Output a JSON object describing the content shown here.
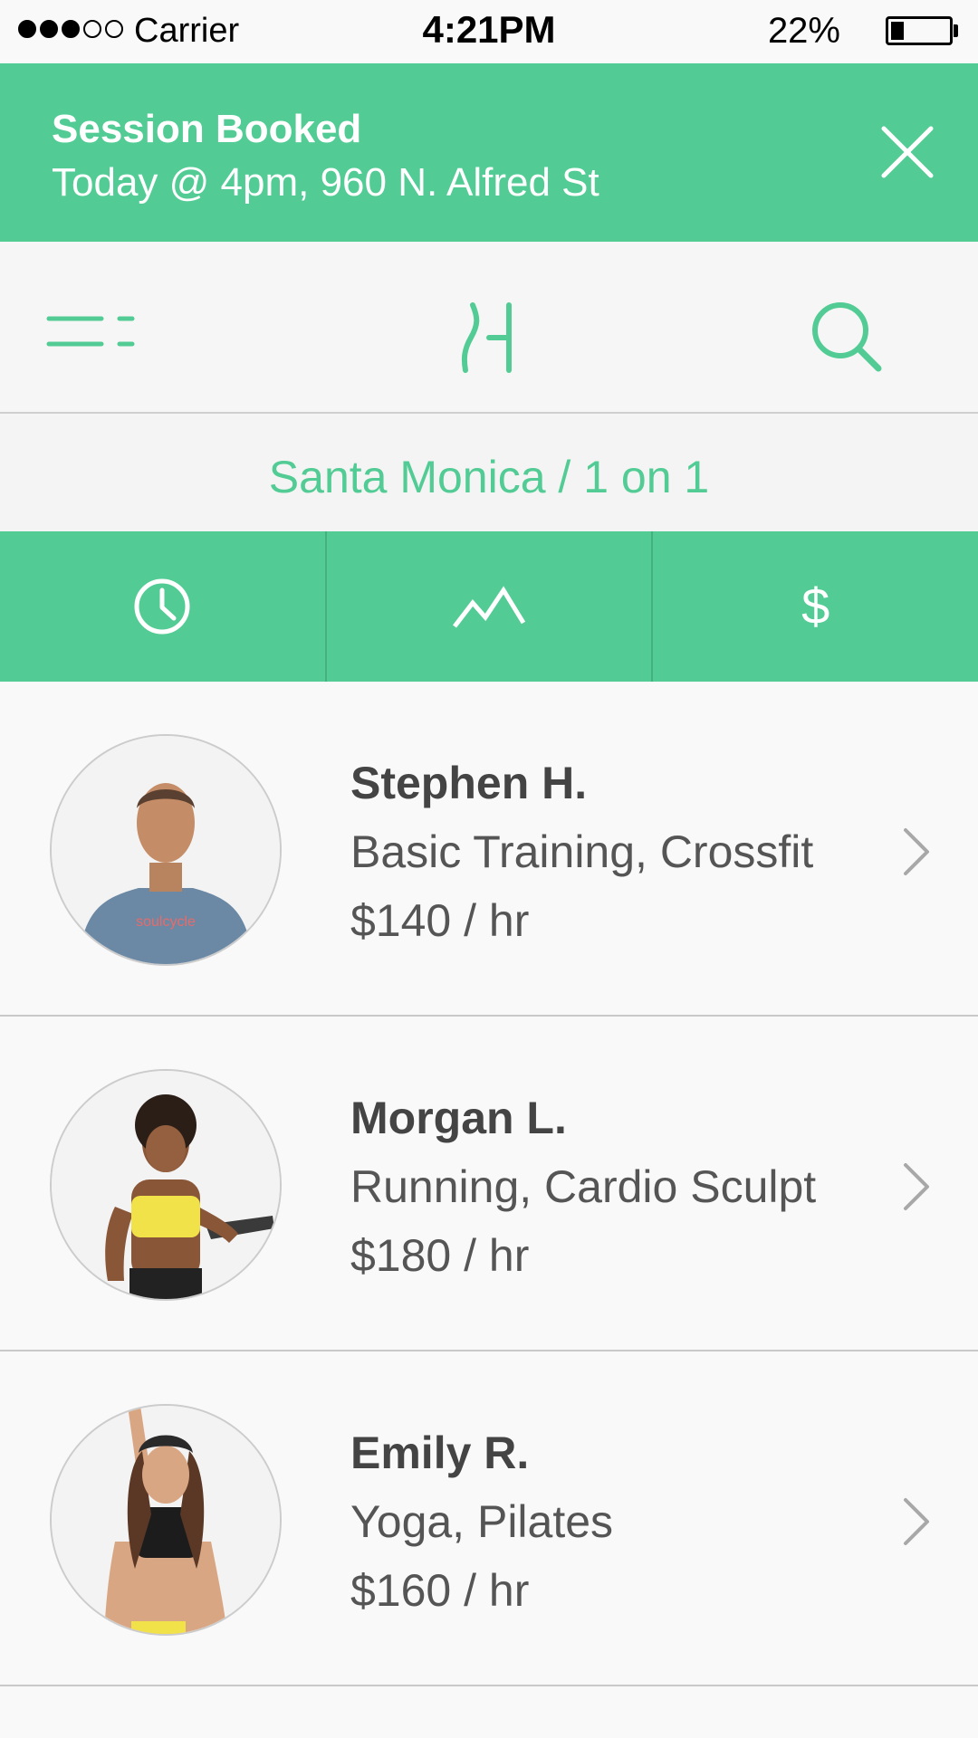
{
  "status_bar": {
    "signal_bars_filled": 3,
    "signal_bars_total": 5,
    "carrier": "Carrier",
    "time": "4:21PM",
    "battery_percent": "22%",
    "battery_level": 0.22
  },
  "banner": {
    "title": "Session Booked",
    "subtitle": "Today @ 4pm, 960 N. Alfred St",
    "close_icon": "close-icon"
  },
  "nav": {
    "menu_icon": "menu-icon",
    "logo_icon": "logo-icon",
    "search_icon": "search-icon"
  },
  "location": {
    "label": "Santa Monica / 1 on 1"
  },
  "filters": [
    {
      "icon": "clock-icon"
    },
    {
      "icon": "mountain-icon"
    },
    {
      "icon": "dollar-icon",
      "glyph": "$"
    }
  ],
  "trainers": [
    {
      "name": "Stephen H.",
      "specialties": "Basic Training, Crossfit",
      "rate": "$140 / hr",
      "shirt_text": "soulcycle"
    },
    {
      "name": "Morgan L.",
      "specialties": "Running, Cardio Sculpt",
      "rate": "$180 / hr"
    },
    {
      "name": "Emily R.",
      "specialties": "Yoga, Pilates",
      "rate": "$160 / hr"
    }
  ],
  "colors": {
    "accent": "#52cc94",
    "text_dark": "#444444",
    "background": "#f9f9f9"
  }
}
